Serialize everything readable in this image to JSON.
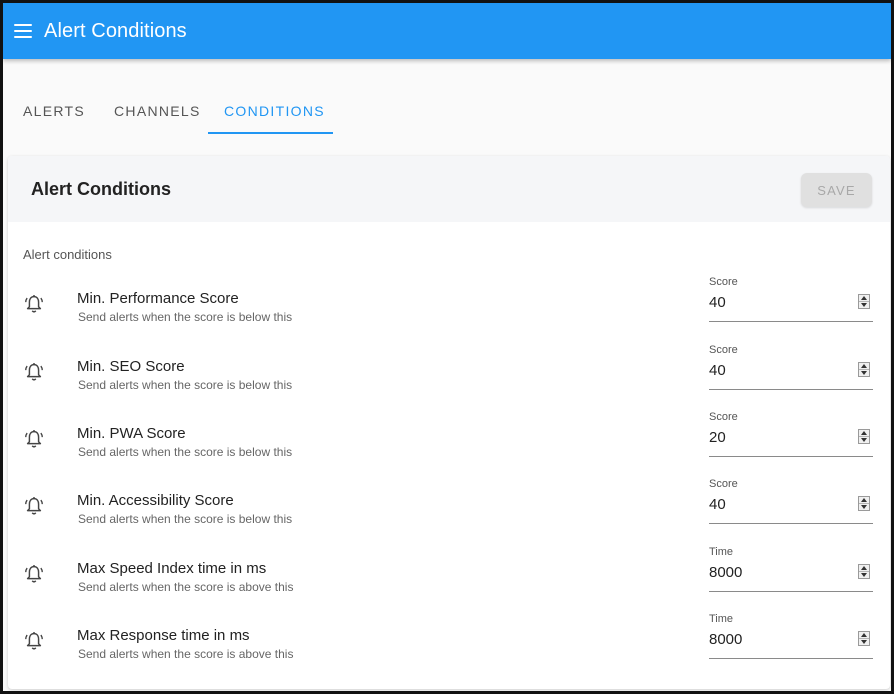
{
  "app": {
    "title": "Alert Conditions",
    "menu_icon": "menu-icon",
    "accent_color": "#2196f3"
  },
  "tabs": [
    {
      "label": "ALERTS",
      "active": false
    },
    {
      "label": "CHANNELS",
      "active": false
    },
    {
      "label": "CONDITIONS",
      "active": true
    }
  ],
  "card": {
    "title": "Alert Conditions",
    "save_label": "SAVE",
    "save_disabled": true,
    "section_label": "Alert conditions"
  },
  "conditions": [
    {
      "icon": "bell-icon",
      "title": "Min. Performance Score",
      "subtitle": "Send alerts when the score is below this",
      "field_label": "Score",
      "value": "40"
    },
    {
      "icon": "bell-icon",
      "title": "Min. SEO Score",
      "subtitle": "Send alerts when the score is below this",
      "field_label": "Score",
      "value": "40"
    },
    {
      "icon": "bell-icon",
      "title": "Min. PWA Score",
      "subtitle": "Send alerts when the score is below this",
      "field_label": "Score",
      "value": "20"
    },
    {
      "icon": "bell-icon",
      "title": "Min. Accessibility Score",
      "subtitle": "Send alerts when the score is below this",
      "field_label": "Score",
      "value": "40"
    },
    {
      "icon": "bell-icon",
      "title": "Max Speed Index time in ms",
      "subtitle": "Send alerts when the score is above this",
      "field_label": "Time",
      "value": "8000"
    },
    {
      "icon": "bell-icon",
      "title": "Max Response time in ms",
      "subtitle": "Send alerts when the score is above this",
      "field_label": "Time",
      "value": "8000"
    }
  ]
}
